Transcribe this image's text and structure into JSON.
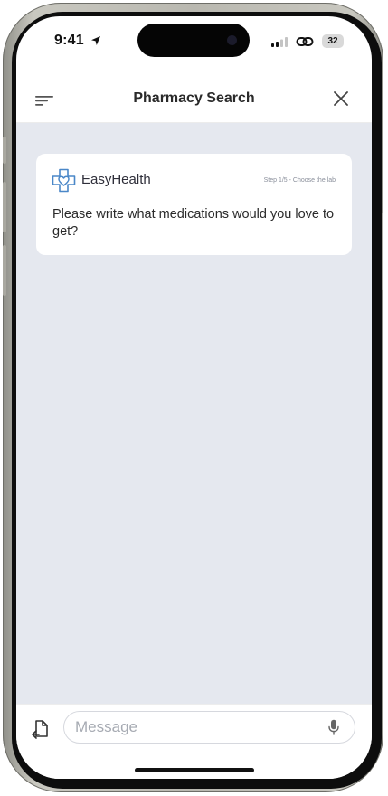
{
  "status_bar": {
    "time": "9:41",
    "battery": "32",
    "icons": [
      "location-arrow-icon",
      "cellular-signal-icon",
      "link-icon",
      "battery-icon"
    ]
  },
  "nav": {
    "title": "Pharmacy Search",
    "left_icon": "menu-icon",
    "right_icon": "close-icon"
  },
  "chat": {
    "messages": [
      {
        "brand": "EasyHealth",
        "step": "Step 1/5 - Choose the lab",
        "text": "Please write what medications would you love to get?"
      }
    ]
  },
  "composer": {
    "placeholder": "Message",
    "value": "",
    "left_icon": "attachment-icon",
    "right_icon": "microphone-icon"
  },
  "colors": {
    "chat_background": "#e5e8ef",
    "brand_accent": "#4a87c8",
    "text": "#2a2a2a"
  }
}
